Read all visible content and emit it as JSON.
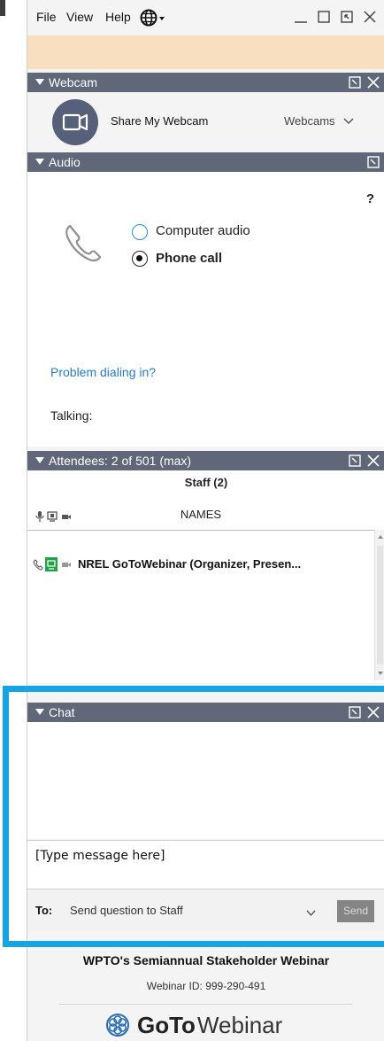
{
  "menu": {
    "file": "File",
    "view": "View",
    "help": "Help"
  },
  "icons": {
    "globe": "globe-icon",
    "minimize": "minimize-icon",
    "restore": "restore-icon",
    "popout": "popout-icon",
    "close": "close-icon",
    "webcam": "webcam-icon",
    "phone": "phone-icon",
    "microphone": "microphone-icon",
    "screen": "screen-icon",
    "camera": "camera-icon",
    "chevron": "chevron-down-icon",
    "help": "help-icon"
  },
  "colors": {
    "header_bar": "#5f6778",
    "notice_bar": "#f7dfbf",
    "link": "#2b7bc4",
    "radio_ring": "#2b8ed6",
    "highlight": "#15a5e2",
    "send_button": "#858585",
    "presenter_green": "#20a246"
  },
  "webcam": {
    "header": "Webcam",
    "share_label": "Share My Webcam",
    "dropdown_label": "Webcams"
  },
  "audio": {
    "header": "Audio",
    "help": "?",
    "options": [
      {
        "label": "Computer audio",
        "selected": false
      },
      {
        "label": "Phone call",
        "selected": true
      }
    ],
    "problem_link": "Problem dialing in?",
    "talking_label": "Talking:"
  },
  "attendees": {
    "header": "Attendees: 2 of 501 (max)",
    "group_label": "Staff (2)",
    "names_header": "NAMES",
    "rows": [
      {
        "name": "NREL GoToWebinar (Organizer, Presen..."
      }
    ]
  },
  "chat": {
    "header": "Chat",
    "message_placeholder": "[Type message here]",
    "to_label": "To:",
    "to_value": "Send question to Staff",
    "send_label": "Send"
  },
  "footer": {
    "webinar_title": "WPTO's Semiannual Stakeholder Webinar",
    "webinar_id": "Webinar ID: 999-290-491",
    "brand_bold": "GoTo",
    "brand_regular": "Webinar"
  }
}
